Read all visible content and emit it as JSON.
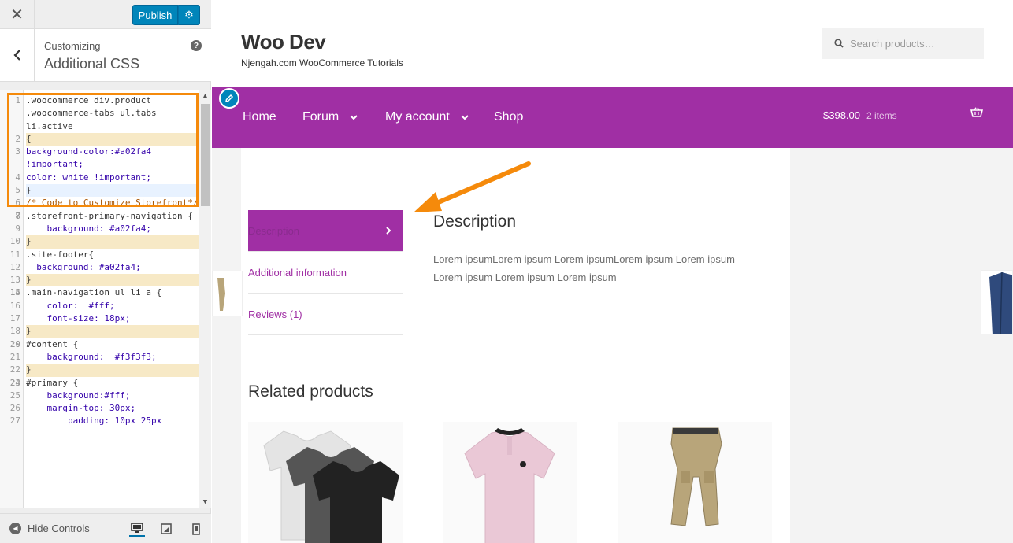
{
  "customizer": {
    "close_icon": "close-icon",
    "publish_label": "Publish",
    "settings_icon": "gear-icon",
    "back_icon": "chevron-left-icon",
    "section_subtitle": "Customizing",
    "section_title": "Additional CSS",
    "help_label": "?",
    "hide_controls_label": "Hide Controls",
    "devices": [
      "desktop-icon",
      "tablet-icon",
      "mobile-icon"
    ],
    "active_device": "desktop"
  },
  "css_editor": {
    "highlight_color": "#f58a0b",
    "lines": [
      {
        "n": "1",
        "text": ".woocommerce div.product .woocommerce-tabs ul.tabs li.active"
      },
      {
        "n": "2",
        "text": "{"
      },
      {
        "n": "3",
        "text": "background-color:#a02fa4 !important;"
      },
      {
        "n": "4",
        "text": "color: white !important;"
      },
      {
        "n": "5",
        "text": "}"
      },
      {
        "n": "6",
        "text": "/* Code to Customize Storefront*/"
      },
      {
        "n": "7",
        "text": ""
      },
      {
        "n": "8",
        "text": ".storefront-primary-navigation {"
      },
      {
        "n": "9",
        "text": "    background: #a02fa4;"
      },
      {
        "n": "10",
        "text": "}"
      },
      {
        "n": "11",
        "text": ".site-footer{"
      },
      {
        "n": "12",
        "text": "  background: #a02fa4;"
      },
      {
        "n": "13",
        "text": "}"
      },
      {
        "n": "14",
        "text": ""
      },
      {
        "n": "15",
        "text": ".main-navigation ul li a {"
      },
      {
        "n": "16",
        "text": "    color:  #fff;"
      },
      {
        "n": "17",
        "text": "    font-size: 18px;"
      },
      {
        "n": "18",
        "text": "}"
      },
      {
        "n": "19",
        "text": ""
      },
      {
        "n": "20",
        "text": "#content {"
      },
      {
        "n": "21",
        "text": "    background:  #f3f3f3;"
      },
      {
        "n": "22",
        "text": "}"
      },
      {
        "n": "23",
        "text": ""
      },
      {
        "n": "24",
        "text": "#primary {"
      },
      {
        "n": "25",
        "text": "    background:#fff;"
      },
      {
        "n": "26",
        "text": "    margin-top: 30px;"
      },
      {
        "n": "27",
        "text": "        padding: 10px 25px"
      }
    ]
  },
  "site": {
    "title": "Woo Dev",
    "tagline": "Njengah.com WooCommerce Tutorials",
    "search_placeholder": "Search products…",
    "brand_color": "#a02fa4",
    "nav": [
      {
        "label": "Home",
        "has_dropdown": false
      },
      {
        "label": "Forum",
        "has_dropdown": true
      },
      {
        "label": "My account",
        "has_dropdown": true
      },
      {
        "label": "Shop",
        "has_dropdown": false
      }
    ],
    "cart": {
      "amount": "$398.00",
      "count": "2 items"
    }
  },
  "product_page": {
    "tabs": [
      {
        "label": "Description",
        "active": true
      },
      {
        "label": "Additional information",
        "active": false
      },
      {
        "label": "Reviews (1)",
        "active": false
      }
    ],
    "description_title": "Description",
    "description_text": "Lorem ipsumLorem ipsum Lorem ipsumLorem ipsum Lorem ipsum Lorem ipsum Lorem ipsum Lorem ipsum",
    "related_title": "Related products",
    "related_products": [
      "v-neck-tshirts-image",
      "pink-polo-shirt-image",
      "khaki-cargo-pants-image"
    ]
  }
}
